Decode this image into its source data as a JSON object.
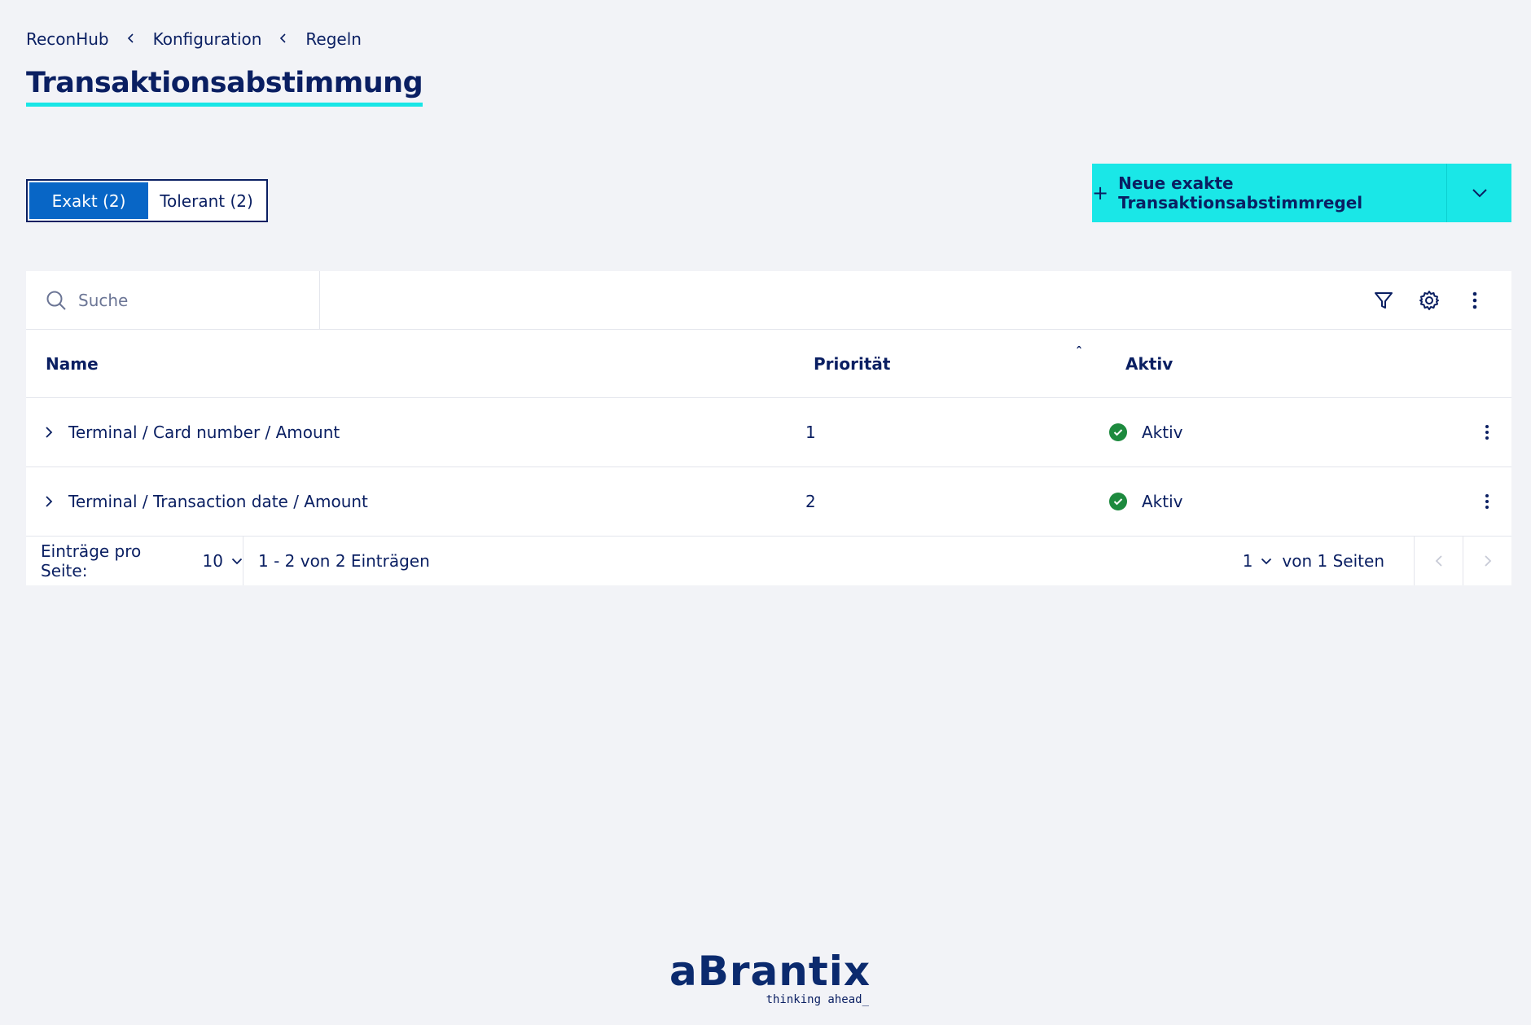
{
  "breadcrumb": [
    "ReconHub",
    "Konfiguration",
    "Regeln"
  ],
  "page": {
    "title": "Transaktionsabstimmung"
  },
  "tabs": [
    {
      "label": "Exakt (2)",
      "active": true
    },
    {
      "label": "Tolerant (2)",
      "active": false
    }
  ],
  "primary_button": {
    "plus": "+",
    "label": "Neue exakte Transaktionsabstimmregel"
  },
  "search": {
    "placeholder": "Suche",
    "value": ""
  },
  "table": {
    "columns": [
      "Name",
      "Priorität",
      "Aktiv"
    ],
    "sort_glyph": "ˆ",
    "rows": [
      {
        "name": "Terminal / Card number / Amount",
        "priority": "1",
        "status": "Aktiv"
      },
      {
        "name": "Terminal / Transaction date / Amount",
        "priority": "2",
        "status": "Aktiv"
      }
    ]
  },
  "pagination": {
    "per_page_label": "Einträge pro Seite:",
    "per_page": "10",
    "range": "1 - 2 von 2 Einträgen",
    "page": "1",
    "of_pages": "von 1 Seiten"
  },
  "logo": {
    "word": "aBrantix",
    "tagline": "thinking ahead_"
  },
  "colors": {
    "accent": "#1ae7e7",
    "primary": "#0866c6",
    "text": "#0a1f62",
    "success": "#1d8a3e"
  }
}
